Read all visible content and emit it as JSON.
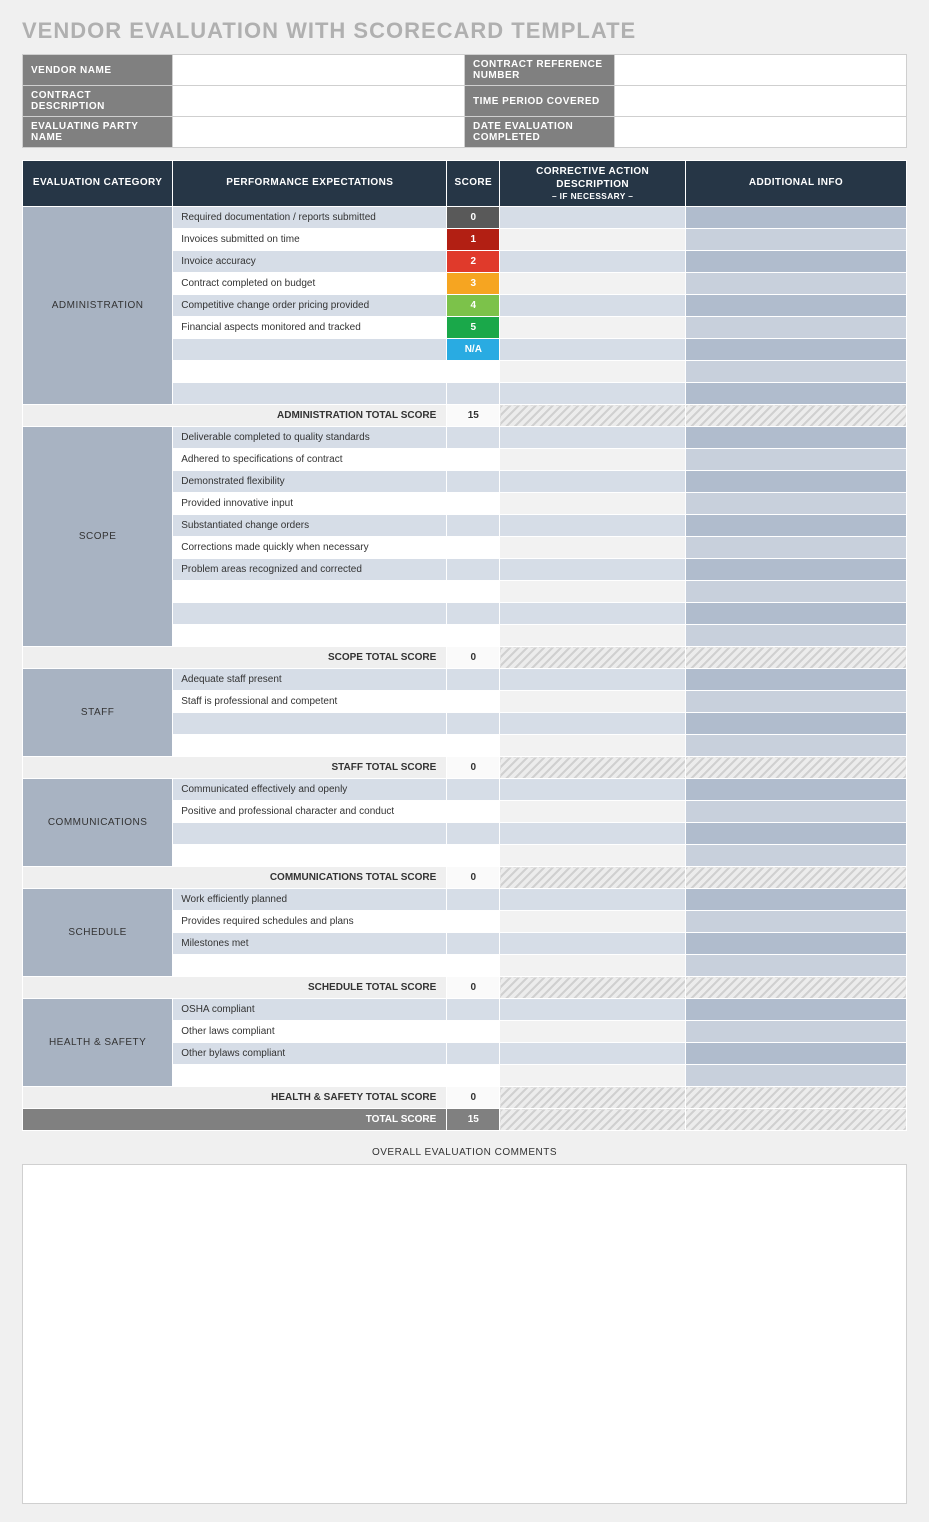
{
  "title": "VENDOR EVALUATION WITH SCORECARD TEMPLATE",
  "info": {
    "labels": {
      "vendor_name": "VENDOR NAME",
      "contract_ref": "CONTRACT REFERENCE NUMBER",
      "contract_desc": "CONTRACT DESCRIPTION",
      "time_period": "TIME PERIOD COVERED",
      "evaluator": "EVALUATING PARTY NAME",
      "date_completed": "DATE EVALUATION COMPLETED"
    },
    "values": {
      "vendor_name": "",
      "contract_ref": "",
      "contract_desc": "",
      "time_period": "",
      "evaluator": "",
      "date_completed": ""
    }
  },
  "headers": {
    "category": "EVALUATION CATEGORY",
    "perf": "PERFORMANCE EXPECTATIONS",
    "score": "SCORE",
    "corr_line1": "CORRECTIVE ACTION DESCRIPTION",
    "corr_line2": "– IF NECESSARY –",
    "info": "ADDITIONAL INFO"
  },
  "sections": [
    {
      "name": "ADMINISTRATION",
      "total_label": "ADMINISTRATION TOTAL SCORE",
      "total_score": "15",
      "rows": [
        {
          "perf": "Required documentation / reports submitted",
          "score": "0",
          "cls": "sc-0"
        },
        {
          "perf": "Invoices submitted on time",
          "score": "1",
          "cls": "sc-1"
        },
        {
          "perf": "Invoice accuracy",
          "score": "2",
          "cls": "sc-2"
        },
        {
          "perf": "Contract completed on budget",
          "score": "3",
          "cls": "sc-3"
        },
        {
          "perf": "Competitive change order pricing provided",
          "score": "4",
          "cls": "sc-4"
        },
        {
          "perf": "Financial aspects monitored and tracked",
          "score": "5",
          "cls": "sc-5"
        },
        {
          "perf": "",
          "score": "N/A",
          "cls": "sc-na"
        },
        {
          "perf": "",
          "score": "",
          "cls": ""
        },
        {
          "perf": "",
          "score": "",
          "cls": ""
        }
      ]
    },
    {
      "name": "SCOPE",
      "total_label": "SCOPE TOTAL SCORE",
      "total_score": "0",
      "rows": [
        {
          "perf": "Deliverable completed to quality standards",
          "score": "",
          "cls": ""
        },
        {
          "perf": "Adhered to specifications of contract",
          "score": "",
          "cls": ""
        },
        {
          "perf": "Demonstrated flexibility",
          "score": "",
          "cls": ""
        },
        {
          "perf": "Provided innovative input",
          "score": "",
          "cls": ""
        },
        {
          "perf": "Substantiated change orders",
          "score": "",
          "cls": ""
        },
        {
          "perf": "Corrections made quickly when necessary",
          "score": "",
          "cls": ""
        },
        {
          "perf": "Problem areas recognized and corrected",
          "score": "",
          "cls": ""
        },
        {
          "perf": "",
          "score": "",
          "cls": ""
        },
        {
          "perf": "",
          "score": "",
          "cls": ""
        },
        {
          "perf": "",
          "score": "",
          "cls": ""
        }
      ]
    },
    {
      "name": "STAFF",
      "total_label": "STAFF TOTAL SCORE",
      "total_score": "0",
      "rows": [
        {
          "perf": "Adequate staff present",
          "score": "",
          "cls": ""
        },
        {
          "perf": "Staff is professional and competent",
          "score": "",
          "cls": ""
        },
        {
          "perf": "",
          "score": "",
          "cls": ""
        },
        {
          "perf": "",
          "score": "",
          "cls": ""
        }
      ]
    },
    {
      "name": "COMMUNICATIONS",
      "total_label": "COMMUNICATIONS TOTAL SCORE",
      "total_score": "0",
      "rows": [
        {
          "perf": "Communicated effectively and openly",
          "score": "",
          "cls": ""
        },
        {
          "perf": "Positive and professional character and conduct",
          "score": "",
          "cls": ""
        },
        {
          "perf": "",
          "score": "",
          "cls": ""
        },
        {
          "perf": "",
          "score": "",
          "cls": ""
        }
      ]
    },
    {
      "name": "SCHEDULE",
      "total_label": "SCHEDULE TOTAL SCORE",
      "total_score": "0",
      "rows": [
        {
          "perf": "Work efficiently planned",
          "score": "",
          "cls": ""
        },
        {
          "perf": "Provides required schedules and plans",
          "score": "",
          "cls": ""
        },
        {
          "perf": "Milestones met",
          "score": "",
          "cls": ""
        },
        {
          "perf": "",
          "score": "",
          "cls": ""
        }
      ]
    },
    {
      "name": "HEALTH & SAFETY",
      "total_label": "HEALTH & SAFETY TOTAL SCORE",
      "total_score": "0",
      "rows": [
        {
          "perf": "OSHA compliant",
          "score": "",
          "cls": ""
        },
        {
          "perf": "Other laws compliant",
          "score": "",
          "cls": ""
        },
        {
          "perf": "Other bylaws compliant",
          "score": "",
          "cls": ""
        },
        {
          "perf": "",
          "score": "",
          "cls": ""
        }
      ]
    }
  ],
  "grand_total": {
    "label": "TOTAL SCORE",
    "score": "15"
  },
  "comments": {
    "label": "OVERALL EVALUATION COMMENTS",
    "value": ""
  }
}
